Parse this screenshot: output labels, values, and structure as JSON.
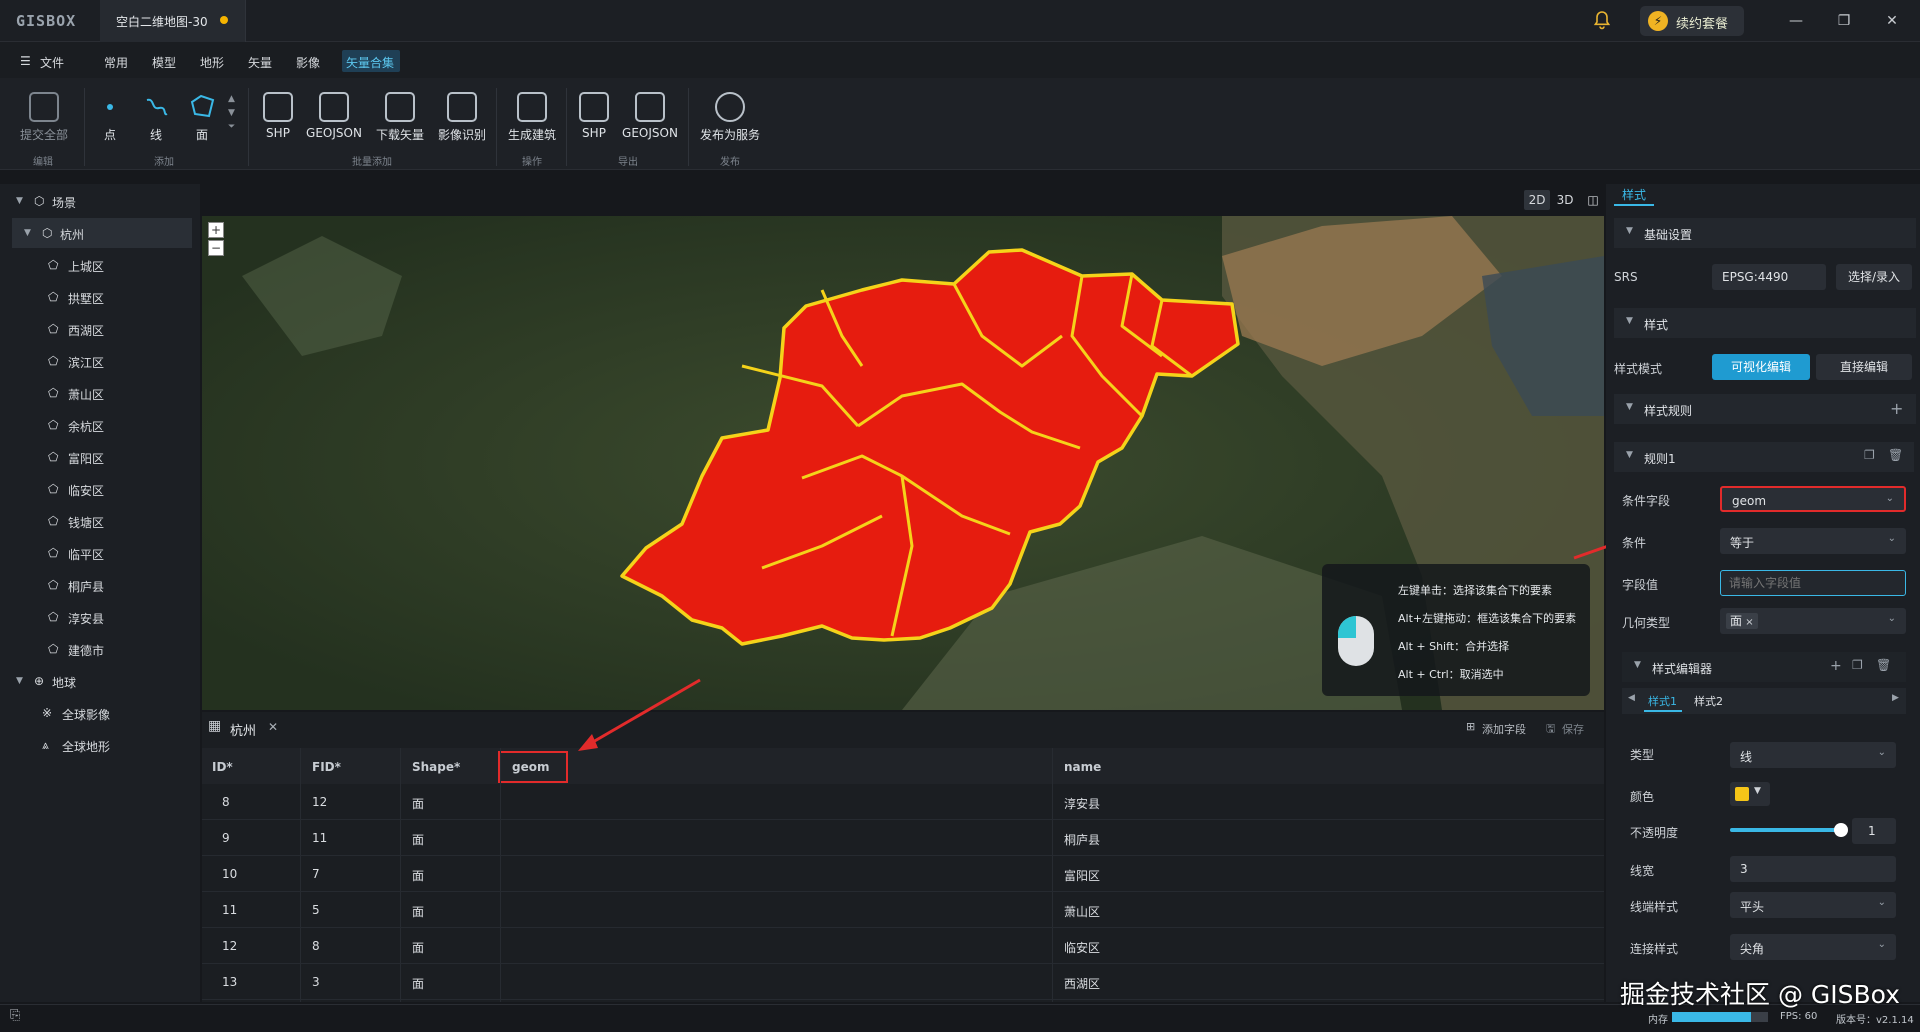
{
  "app": {
    "logo": "GISBOX",
    "doc_tab": "空白二维地图-30",
    "renew_label": "续约套餐"
  },
  "colors": {
    "accent": "#3ab8e6",
    "unsaved_dot": "#f5b400",
    "region_fill": "#e61c0f",
    "region_stroke": "#f5d31a",
    "highlight_box": "#e22b2b"
  },
  "menu": {
    "file": "文件",
    "items": [
      "常用",
      "模型",
      "地形",
      "矢量",
      "影像",
      "矢量合集"
    ]
  },
  "toolbar": {
    "tools": [
      "提交全部",
      "点",
      "线",
      "面",
      "SHP",
      "GEOJSON",
      "下载矢量",
      "影像识别",
      "生成建筑",
      "SHP",
      "GEOJSON",
      "发布为服务"
    ],
    "groups": [
      "编辑",
      "添加",
      "批量添加",
      "操作",
      "导出",
      "发布"
    ]
  },
  "tree": {
    "scene_label": "场景",
    "city": "杭州",
    "districts": [
      "上城区",
      "拱墅区",
      "西湖区",
      "滨江区",
      "萧山区",
      "余杭区",
      "富阳区",
      "临安区",
      "钱塘区",
      "临平区",
      "桐庐县",
      "淳安县",
      "建德市"
    ],
    "globe_label": "地球",
    "globe_items": [
      "全球影像",
      "全球地形"
    ]
  },
  "view_modes": [
    "2D",
    "3D",
    "◫"
  ],
  "map": {
    "zoom_in": "+",
    "zoom_out": "−",
    "tips": [
      "左键单击：选择该集合下的要素",
      "Alt+左键拖动：框选该集合下的要素",
      "Alt + Shift：合并选择",
      "Alt + Ctrl：取消选中"
    ]
  },
  "table": {
    "tab": "杭州",
    "add_field": "添加字段",
    "save": "保存",
    "columns": [
      "ID*",
      "FID*",
      "Shape*",
      "geom",
      "name"
    ],
    "rows": [
      [
        "8",
        "12",
        "面",
        "",
        "淳安县"
      ],
      [
        "9",
        "11",
        "面",
        "",
        "桐庐县"
      ],
      [
        "10",
        "7",
        "面",
        "",
        "富阳区"
      ],
      [
        "11",
        "5",
        "面",
        "",
        "萧山区"
      ],
      [
        "12",
        "8",
        "面",
        "",
        "临安区"
      ],
      [
        "13",
        "3",
        "面",
        "",
        "西湖区"
      ]
    ]
  },
  "panel": {
    "tab": "样式",
    "basic_settings": "基础设置",
    "srs_label": "SRS",
    "srs_value": "EPSG:4490",
    "srs_button": "选择/录入",
    "style_section": "样式",
    "style_mode_label": "样式模式",
    "mode_visual": "可视化编辑",
    "mode_direct": "直接编辑",
    "style_rules": "样式规则",
    "rule1": "规则1",
    "condition_field_label": "条件字段",
    "condition_field_value": "geom",
    "condition_label": "条件",
    "condition_value": "等于",
    "field_value_label": "字段值",
    "field_value_placeholder": "请输入字段值",
    "geom_type_label": "几何类型",
    "geom_type_tag": "面",
    "style_editor": "样式编辑器",
    "style_tabs": [
      "样式1",
      "样式2"
    ],
    "type_label": "类型",
    "type_value": "线",
    "color_label": "颜色",
    "color_value": "#f5c518",
    "opacity_label": "不透明度",
    "opacity_value": "1",
    "line_width_label": "线宽",
    "line_width_value": "3",
    "line_cap_label": "线端样式",
    "line_cap_value": "平头",
    "line_join_label": "连接样式",
    "line_join_value": "尖角"
  },
  "status": {
    "memory_label": "内存",
    "memory_fraction": 0.82,
    "fps": "FPS: 60",
    "version": "版本号：v2.1.14"
  },
  "watermark": "掘金技术社区 @ GISBox"
}
